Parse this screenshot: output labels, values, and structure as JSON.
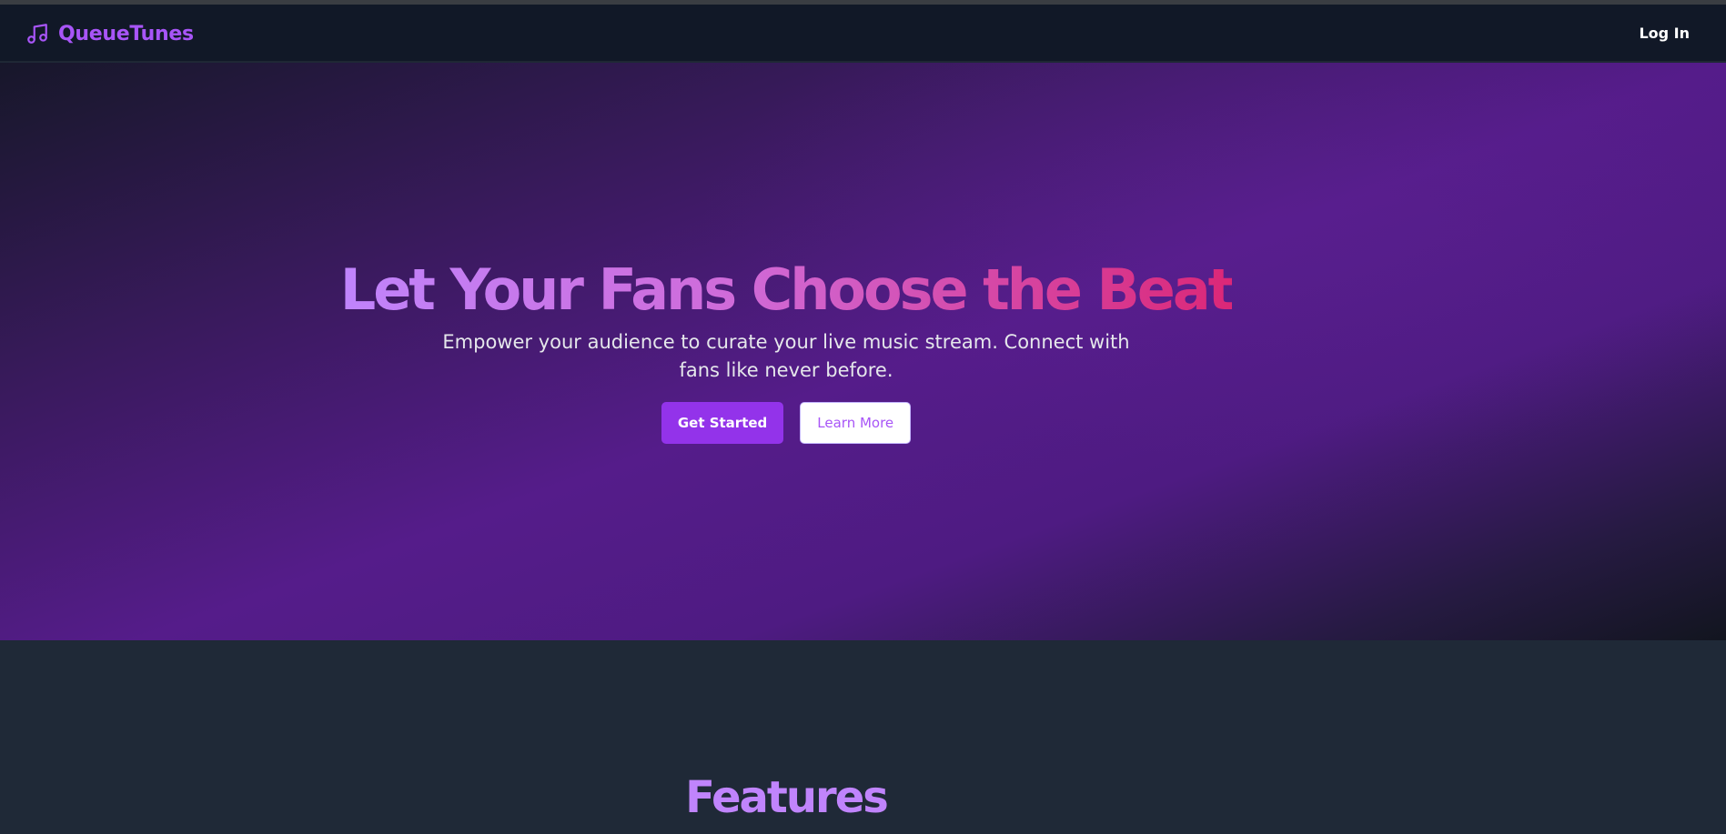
{
  "nav": {
    "brand_name": "QueueTunes",
    "brand_icon": "music-note-icon",
    "login_label": "Log In"
  },
  "hero": {
    "title": "Let Your Fans Choose the Beat",
    "subtitle": "Empower your audience to curate your live music stream. Connect with fans like never before.",
    "primary_button": "Get Started",
    "secondary_button": "Learn More"
  },
  "features": {
    "title": "Features"
  },
  "colors": {
    "brand_purple": "#a855f7",
    "primary_button": "#9333ea",
    "gradient_start": "#c084fc",
    "gradient_end": "#db2777",
    "nav_bg": "#111827",
    "section_bg": "#1f2937"
  }
}
